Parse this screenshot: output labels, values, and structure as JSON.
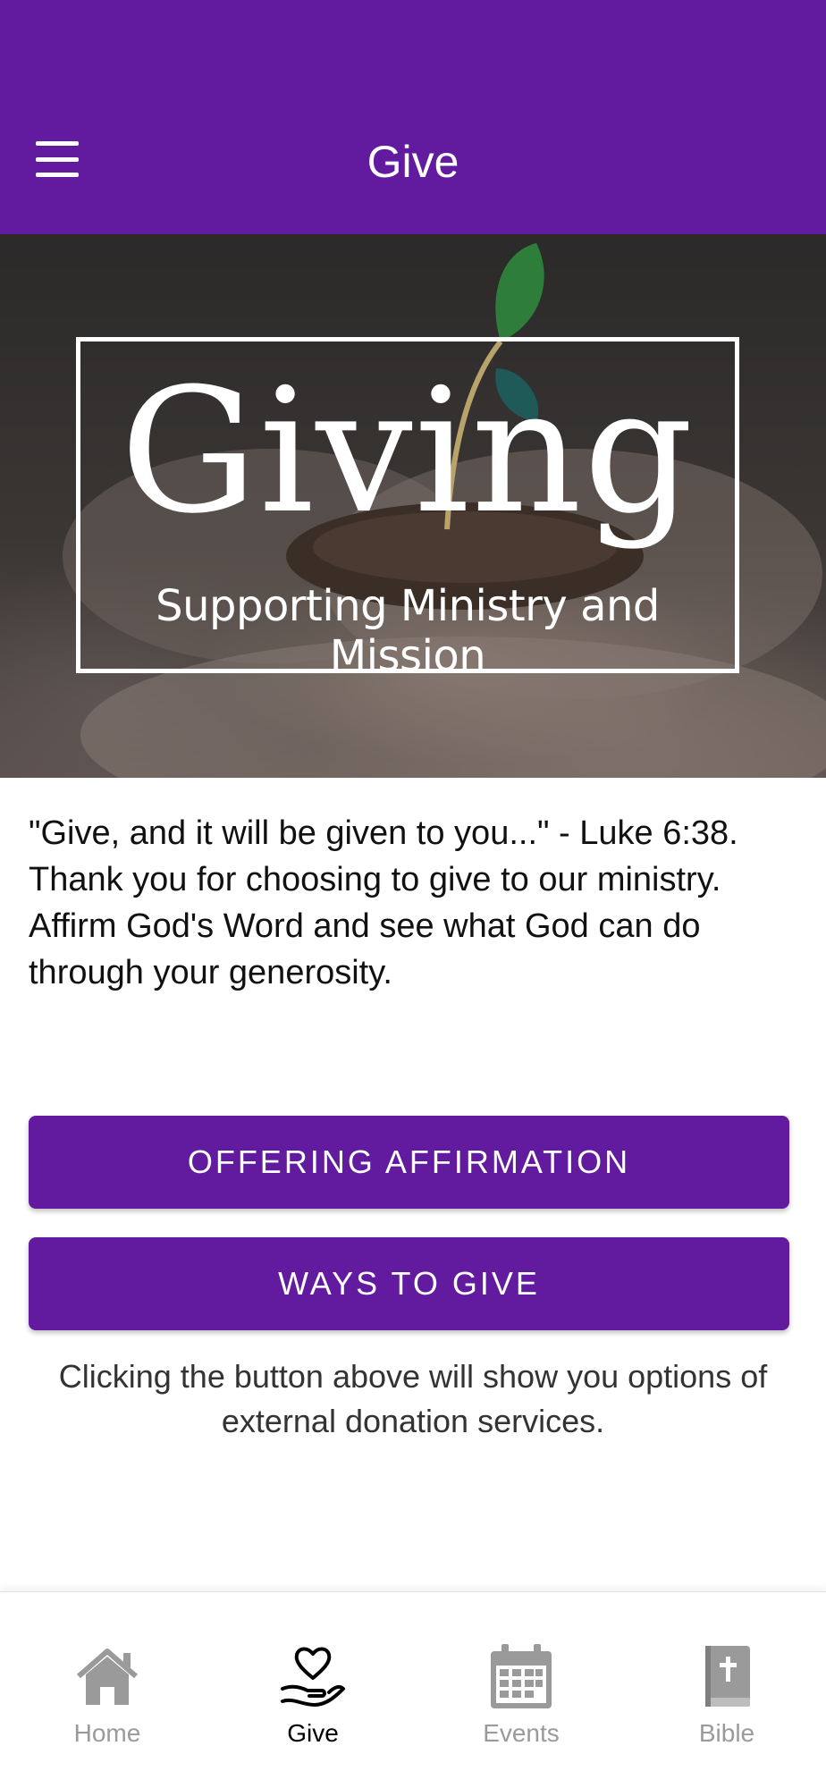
{
  "header": {
    "title": "Give",
    "menu_icon": "hamburger-menu-icon",
    "background": "#621a9e"
  },
  "hero": {
    "heading": "Giving",
    "subheading": "Supporting Ministry and Mission"
  },
  "intro": {
    "text": "\"Give, and it will be given to you...\" - Luke 6:38. Thank you for choosing to give to our ministry. Affirm God's Word and see what God can do through your generosity."
  },
  "buttons": {
    "offering_affirmation": "OFFERING AFFIRMATION",
    "ways_to_give": "WAYS TO GIVE",
    "color": "#621a9e"
  },
  "note": {
    "text": "Clicking the button above will show you options of external donation services."
  },
  "tabbar": {
    "active": "Give",
    "items": [
      {
        "label": "Home",
        "icon": "house-icon"
      },
      {
        "label": "Give",
        "icon": "heart-hand-icon"
      },
      {
        "label": "Events",
        "icon": "calendar-icon"
      },
      {
        "label": "Bible",
        "icon": "bible-icon"
      }
    ]
  }
}
